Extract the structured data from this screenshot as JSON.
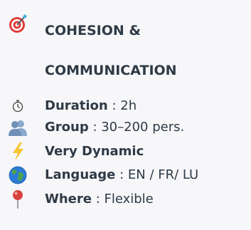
{
  "header": {
    "icon": "target-dart-icon",
    "title_line_1": "COHESION &",
    "title_line_2": "COMMUNICATION"
  },
  "details": [
    {
      "icon": "stopwatch-icon",
      "label": "Duration",
      "value": " : 2h"
    },
    {
      "icon": "people-icon",
      "label": "Group",
      "value": " : 30–200 pers."
    },
    {
      "icon": "lightning-icon",
      "label": "Very Dynamic",
      "value": ""
    },
    {
      "icon": "globe-icon",
      "label": "Language",
      "value": " : EN / FR/ LU"
    },
    {
      "icon": "location-pin-icon",
      "label": "Where",
      "value": " : Flexible"
    }
  ],
  "colors": {
    "text": "#2f3a46",
    "background": "#f7f7f9",
    "target_red": "#e03c3c",
    "people_blue": "#7c9bc0",
    "lightning_yellow": "#f9c332",
    "globe_blue": "#2a7ad9",
    "globe_green": "#4fa34b",
    "pin_red": "#d8423e"
  }
}
